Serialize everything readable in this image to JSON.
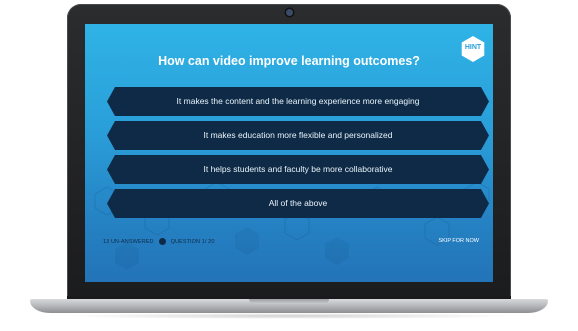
{
  "quiz": {
    "question": "How can video improve learning outcomes?",
    "hint_label": "HINT",
    "answers": [
      {
        "label": "It makes the content and the learning experience more engaging"
      },
      {
        "label": "It makes education more flexible and personalized"
      },
      {
        "label": "It helps students and faculty be more collaborative"
      },
      {
        "label": "All of the above"
      }
    ],
    "unanswered_status": "13 UN-ANSWERED",
    "question_progress": "QUESTION 1/ 20",
    "skip_label": "SKIP FOR NOW"
  },
  "colors": {
    "screen_top": "#2fb3e6",
    "screen_bottom": "#2373b8",
    "answer_fill": "#0f2a46",
    "hint_fill": "#ffffff",
    "hint_text": "#2a9fd9"
  },
  "icons": {
    "hint": "hexagon-icon",
    "status": "dot-icon",
    "answer_shape": "hexagon-bar"
  }
}
